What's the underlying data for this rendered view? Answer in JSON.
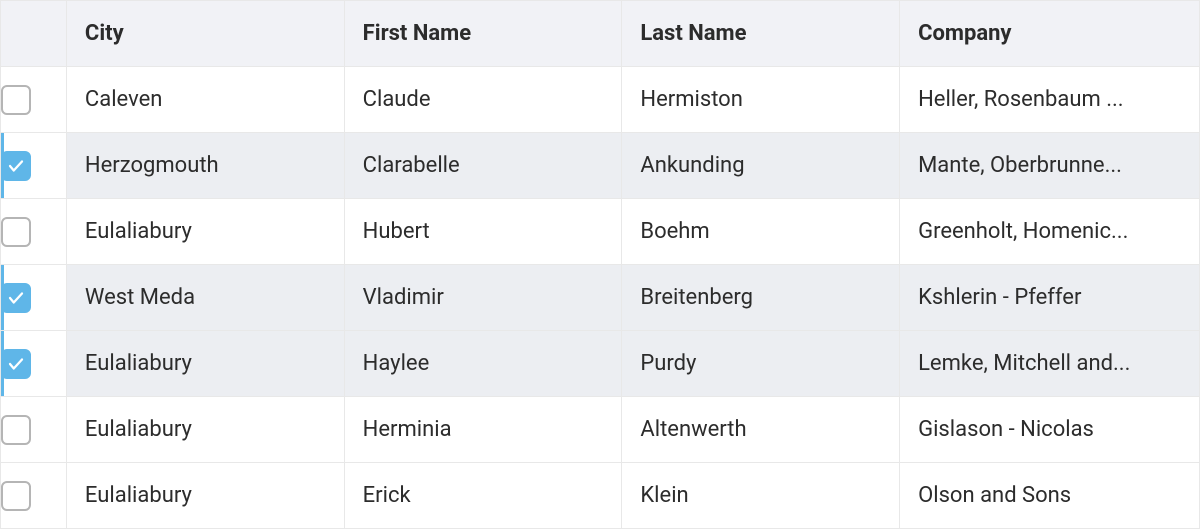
{
  "columns": {
    "city": "City",
    "first_name": "First Name",
    "last_name": "Last Name",
    "company": "Company"
  },
  "rows": [
    {
      "selected": false,
      "city": "Caleven",
      "first_name": "Claude",
      "last_name": "Hermiston",
      "company": "Heller, Rosenbaum ..."
    },
    {
      "selected": true,
      "city": "Herzogmouth",
      "first_name": "Clarabelle",
      "last_name": "Ankunding",
      "company": "Mante, Oberbrunne..."
    },
    {
      "selected": false,
      "city": "Eulaliabury",
      "first_name": "Hubert",
      "last_name": "Boehm",
      "company": "Greenholt, Homenic..."
    },
    {
      "selected": true,
      "city": "West Meda",
      "first_name": "Vladimir",
      "last_name": "Breitenberg",
      "company": "Kshlerin - Pfeffer"
    },
    {
      "selected": true,
      "city": "Eulaliabury",
      "first_name": "Haylee",
      "last_name": "Purdy",
      "company": "Lemke, Mitchell and..."
    },
    {
      "selected": false,
      "city": "Eulaliabury",
      "first_name": "Herminia",
      "last_name": "Altenwerth",
      "company": "Gislason - Nicolas"
    },
    {
      "selected": false,
      "city": "Eulaliabury",
      "first_name": "Erick",
      "last_name": "Klein",
      "company": "Olson and Sons"
    }
  ]
}
